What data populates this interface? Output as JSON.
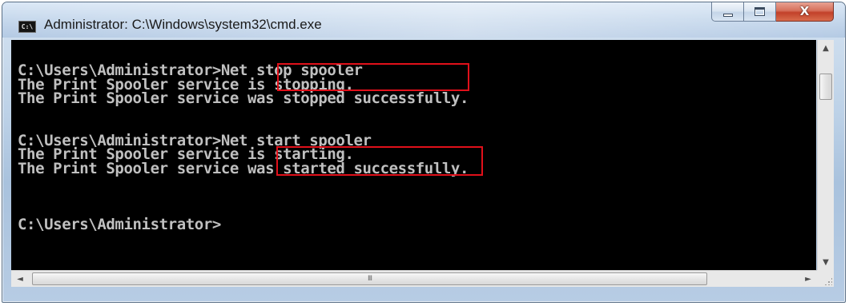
{
  "window": {
    "title": "Administrator: C:\\Windows\\system32\\cmd.exe",
    "icon_label": "C:\\",
    "icon": "command-prompt-icon"
  },
  "controls": {
    "minimize_icon": "minimize-icon",
    "maximize_icon": "maximize-icon",
    "close_icon": "close-icon",
    "close_glyph": "X"
  },
  "console": {
    "lines": [
      "C:\\Users\\Administrator>Net stop spooler",
      "The Print Spooler service is stopping.",
      "The Print Spooler service was stopped successfully.",
      "",
      "",
      "C:\\Users\\Administrator>Net start spooler",
      "The Print Spooler service is starting.",
      "The Print Spooler service was started successfully.",
      "",
      "",
      "",
      "C:\\Users\\Administrator>"
    ],
    "highlighted_commands": [
      "Net stop spooler",
      "Net start spooler"
    ],
    "highlight_color": "#e1101a",
    "text_color": "#c0c0c0",
    "background_color": "#000000"
  },
  "scrollbars": {
    "up_arrow": "▲",
    "down_arrow": "▼",
    "left_arrow": "◄",
    "right_arrow": "►",
    "grip": "III"
  }
}
